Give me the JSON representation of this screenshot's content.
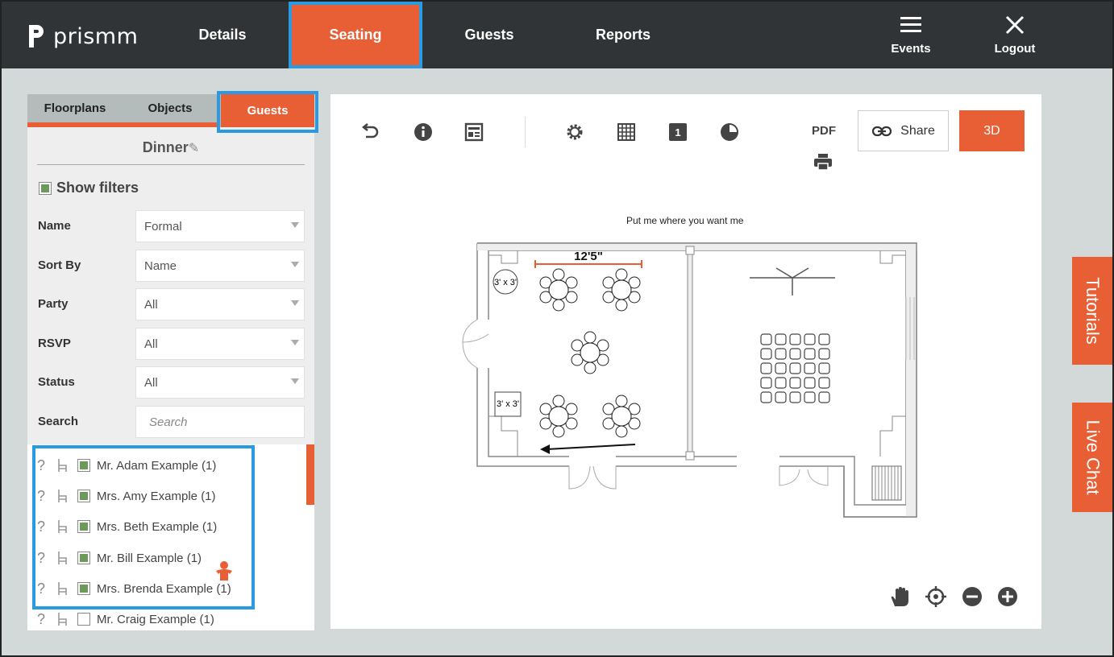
{
  "app": {
    "logo_text": "prismm"
  },
  "nav": {
    "tabs": [
      {
        "label": "Details"
      },
      {
        "label": "Seating"
      },
      {
        "label": "Guests"
      },
      {
        "label": "Reports"
      }
    ],
    "events_label": "Events",
    "logout_label": "Logout"
  },
  "panel": {
    "subtabs": [
      {
        "label": "Floorplans"
      },
      {
        "label": "Objects"
      },
      {
        "label": "Guests"
      }
    ],
    "list_title": "Dinner",
    "show_filters_label": "Show filters",
    "filters": [
      {
        "label": "Name",
        "value": "Formal"
      },
      {
        "label": "Sort By",
        "value": "Name"
      },
      {
        "label": "Party",
        "value": "All"
      },
      {
        "label": "RSVP",
        "value": "All"
      },
      {
        "label": "Status",
        "value": "All"
      },
      {
        "label": "Search",
        "placeholder": "Search"
      }
    ],
    "guests": [
      {
        "name": "Mr. Adam Example (1)",
        "checked": true
      },
      {
        "name": "Mrs. Amy Example (1)",
        "checked": true
      },
      {
        "name": "Mrs. Beth Example (1)",
        "checked": true
      },
      {
        "name": "Mr. Bill Example (1)",
        "checked": true
      },
      {
        "name": "Mrs. Brenda Example (1)",
        "checked": true
      },
      {
        "name": "Mr. Craig Example (1)",
        "checked": false
      }
    ]
  },
  "canvas": {
    "pdf_label": "PDF",
    "share_label": "Share",
    "btn_3d_label": "3D",
    "layer_number": "1",
    "plan_label": "Put me where you want me",
    "dimension_label": "12'5\"",
    "table_label_1": "3' x 3'",
    "table_label_2": "3' x 3'"
  },
  "side_tabs": {
    "tutorials": "Tutorials",
    "live_chat": "Live Chat"
  },
  "colors": {
    "accent": "#e95f35",
    "topbar": "#313436",
    "highlight": "#2a9be2",
    "checkbox": "#6b9a5a"
  }
}
